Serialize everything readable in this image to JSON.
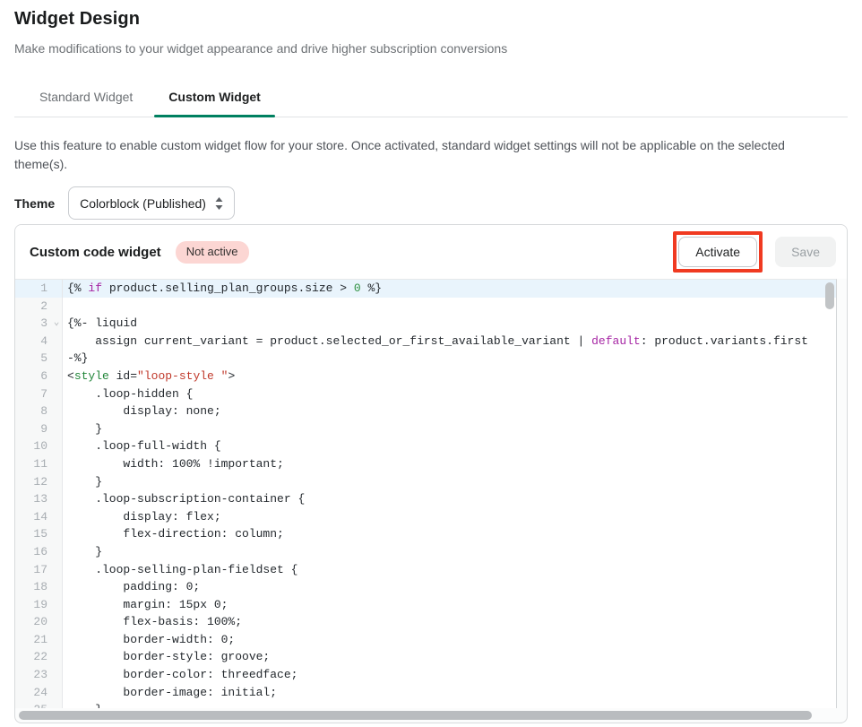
{
  "page": {
    "title": "Widget Design",
    "subtitle": "Make modifications to your widget appearance and drive higher subscription conversions"
  },
  "tabs": [
    {
      "label": "Standard Widget",
      "active": false
    },
    {
      "label": "Custom Widget",
      "active": true
    }
  ],
  "description": "Use this feature to enable custom widget flow for your store. Once activated, standard widget settings will not be applicable on the selected theme(s).",
  "theme": {
    "label": "Theme",
    "selected": "Colorblock (Published)"
  },
  "panel": {
    "title": "Custom code widget",
    "badge": "Not active",
    "activate_label": "Activate",
    "save_label": "Save",
    "save_disabled": true
  },
  "colors": {
    "tab_active_underline": "#008060",
    "badge_bg": "#fcd6d3",
    "annotation_highlight": "#f03a21",
    "active_line_bg": "#e9f4fc",
    "keyword": "#a626a4",
    "number": "#2e9140",
    "tag": "#22863a",
    "string": "#c0392b"
  },
  "editor": {
    "active_line": 1,
    "fold_line": 3,
    "token_types": {
      "p": "plain",
      "k": "keyword",
      "n": "number",
      "t": "tag",
      "s": "string"
    },
    "lines": [
      [
        [
          "{% ",
          "p"
        ],
        [
          "if",
          "k"
        ],
        [
          " product.selling_plan_groups.size > ",
          "p"
        ],
        [
          "0",
          "n"
        ],
        [
          " %}",
          "p"
        ]
      ],
      [],
      [
        [
          "{%- liquid",
          "p"
        ]
      ],
      [
        [
          "    assign current_variant = product.selected_or_first_available_variant | ",
          "p"
        ],
        [
          "default",
          "k"
        ],
        [
          ": product.variants.first",
          "p"
        ]
      ],
      [
        [
          "-%}",
          "p"
        ]
      ],
      [
        [
          "<",
          "p"
        ],
        [
          "style",
          "t"
        ],
        [
          " id=",
          "p"
        ],
        [
          "\"loop-style \"",
          "s"
        ],
        [
          ">",
          "p"
        ]
      ],
      [
        [
          "    .loop-hidden {",
          "p"
        ]
      ],
      [
        [
          "        display: none;",
          "p"
        ]
      ],
      [
        [
          "    }",
          "p"
        ]
      ],
      [
        [
          "    .loop-full-width {",
          "p"
        ]
      ],
      [
        [
          "        width: 100% !important;",
          "p"
        ]
      ],
      [
        [
          "    }",
          "p"
        ]
      ],
      [
        [
          "    .loop-subscription-container {",
          "p"
        ]
      ],
      [
        [
          "        display: flex;",
          "p"
        ]
      ],
      [
        [
          "        flex-direction: column;",
          "p"
        ]
      ],
      [
        [
          "    }",
          "p"
        ]
      ],
      [
        [
          "    .loop-selling-plan-fieldset {",
          "p"
        ]
      ],
      [
        [
          "        padding: 0;",
          "p"
        ]
      ],
      [
        [
          "        margin: 15px 0;",
          "p"
        ]
      ],
      [
        [
          "        flex-basis: 100%;",
          "p"
        ]
      ],
      [
        [
          "        border-width: 0;",
          "p"
        ]
      ],
      [
        [
          "        border-style: groove;",
          "p"
        ]
      ],
      [
        [
          "        border-color: threedface;",
          "p"
        ]
      ],
      [
        [
          "        border-image: initial;",
          "p"
        ]
      ],
      [
        [
          "    }",
          "p"
        ]
      ]
    ]
  }
}
